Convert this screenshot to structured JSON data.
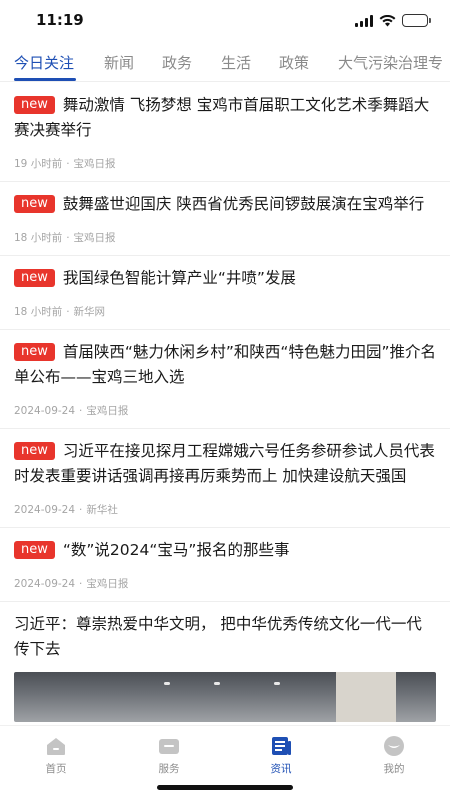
{
  "status": {
    "time": "11:19",
    "battery_level": 0.75
  },
  "tabs": [
    {
      "label": "今日关注",
      "active": true
    },
    {
      "label": "新闻"
    },
    {
      "label": "政务"
    },
    {
      "label": "生活"
    },
    {
      "label": "政策"
    },
    {
      "label": "大气污染治理专"
    }
  ],
  "articles": [
    {
      "badge": "new",
      "title": "舞动激情 飞扬梦想 宝鸡市首届职工文化艺术季舞蹈大赛决赛举行",
      "time": "19 小时前",
      "sep": "·",
      "source": "宝鸡日报"
    },
    {
      "badge": "new",
      "title": "鼓舞盛世迎国庆 陕西省优秀民间锣鼓展演在宝鸡举行",
      "time": "18 小时前",
      "sep": "·",
      "source": "宝鸡日报"
    },
    {
      "badge": "new",
      "title": "我国绿色智能计算产业“井喷”发展",
      "time": "18 小时前",
      "sep": "·",
      "source": "新华网"
    },
    {
      "badge": "new",
      "title": "首届陕西“魅力休闲乡村”和陕西“特色魅力田园”推介名单公布——宝鸡三地入选",
      "time": "2024-09-24",
      "sep": "·",
      "source": "宝鸡日报"
    },
    {
      "badge": "new",
      "title": "习近平在接见探月工程嫦娥六号任务参研参试人员代表时发表重要讲话强调再接再厉乘势而上 加快建设航天强国",
      "time": "2024-09-24",
      "sep": "·",
      "source": "新华社"
    },
    {
      "badge": "new",
      "title": "“数”说2024“宝马”报名的那些事",
      "time": "2024-09-24",
      "sep": "·",
      "source": "宝鸡日报"
    }
  ],
  "featured": {
    "title": "习近平：尊崇热爱中华文明， 把中华优秀传统文化一代一代传下去"
  },
  "nav": [
    {
      "label": "首页",
      "icon": "home-icon"
    },
    {
      "label": "服务",
      "icon": "service-icon"
    },
    {
      "label": "资讯",
      "icon": "news-icon",
      "active": true
    },
    {
      "label": "我的",
      "icon": "profile-icon"
    }
  ],
  "colors": {
    "accent": "#1e4fb4",
    "badge": "#e8352c",
    "inactive": "#8c8c8c"
  }
}
